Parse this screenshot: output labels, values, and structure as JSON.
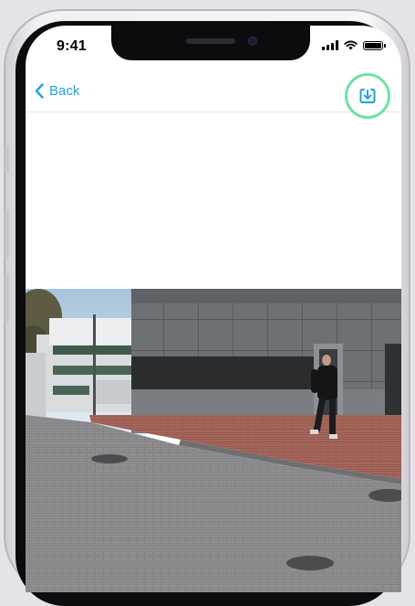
{
  "status_bar": {
    "time": "9:41",
    "icons": [
      "cellular-signal-icon",
      "wifi-icon",
      "battery-icon"
    ]
  },
  "nav": {
    "back_label": "Back",
    "download_icon": "download-icon",
    "accent_color": "#1ea3e0",
    "highlight_color": "#6ee0ac"
  },
  "photo": {
    "icon": "photo-capture"
  }
}
